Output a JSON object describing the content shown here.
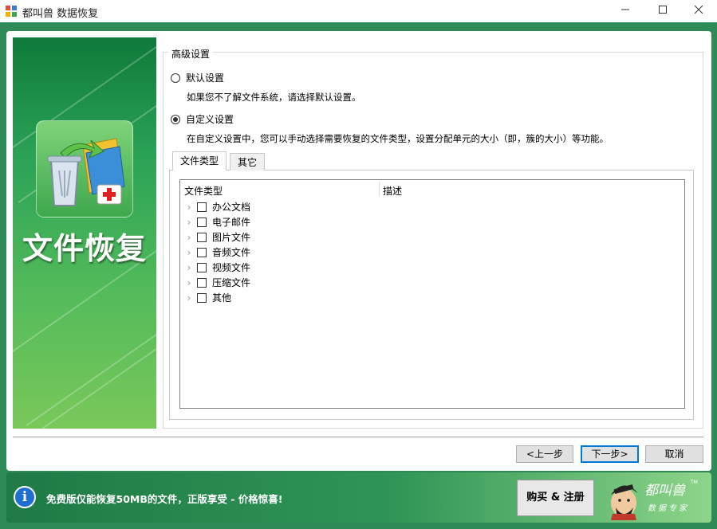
{
  "window": {
    "title": "都叫兽 数据恢复",
    "minimize_icon": "minimize-icon",
    "maximize_icon": "maximize-icon",
    "close_icon": "close-icon"
  },
  "sidebar": {
    "banner_title": "文件恢复",
    "banner_icon": "recycle-bin-recovery-icon"
  },
  "settings": {
    "group_title": "高级设置",
    "default_option": {
      "label": "默认设置",
      "selected": false,
      "description": "如果您不了解文件系统，请选择默认设置。"
    },
    "custom_option": {
      "label": "自定义设置",
      "selected": true,
      "description": "在自定义设置中，您可以手动选择需要恢复的文件类型，设置分配单元的大小（即，簇的大小）等功能。"
    },
    "tabs": [
      {
        "label": "文件类型",
        "active": true
      },
      {
        "label": "其它",
        "active": false
      }
    ],
    "columns": [
      "文件类型",
      "描述"
    ],
    "file_types": [
      {
        "label": "办公文档",
        "checked": false
      },
      {
        "label": "电子邮件",
        "checked": false
      },
      {
        "label": "图片文件",
        "checked": false
      },
      {
        "label": "音频文件",
        "checked": false
      },
      {
        "label": "视频文件",
        "checked": false
      },
      {
        "label": "压缩文件",
        "checked": false
      },
      {
        "label": "其他",
        "checked": false
      }
    ]
  },
  "buttons": {
    "prev": "<上一步",
    "next": "下一步>",
    "cancel": "取消"
  },
  "footer": {
    "info_icon": "info-icon",
    "message": "免费版仅能恢复50MB的文件，正版享受 - 价格惊喜!",
    "buy_button": "购买 & 注册",
    "logo_text": "都叫兽",
    "logo_subtitle": "数据专家",
    "logo_tm": "TM"
  }
}
